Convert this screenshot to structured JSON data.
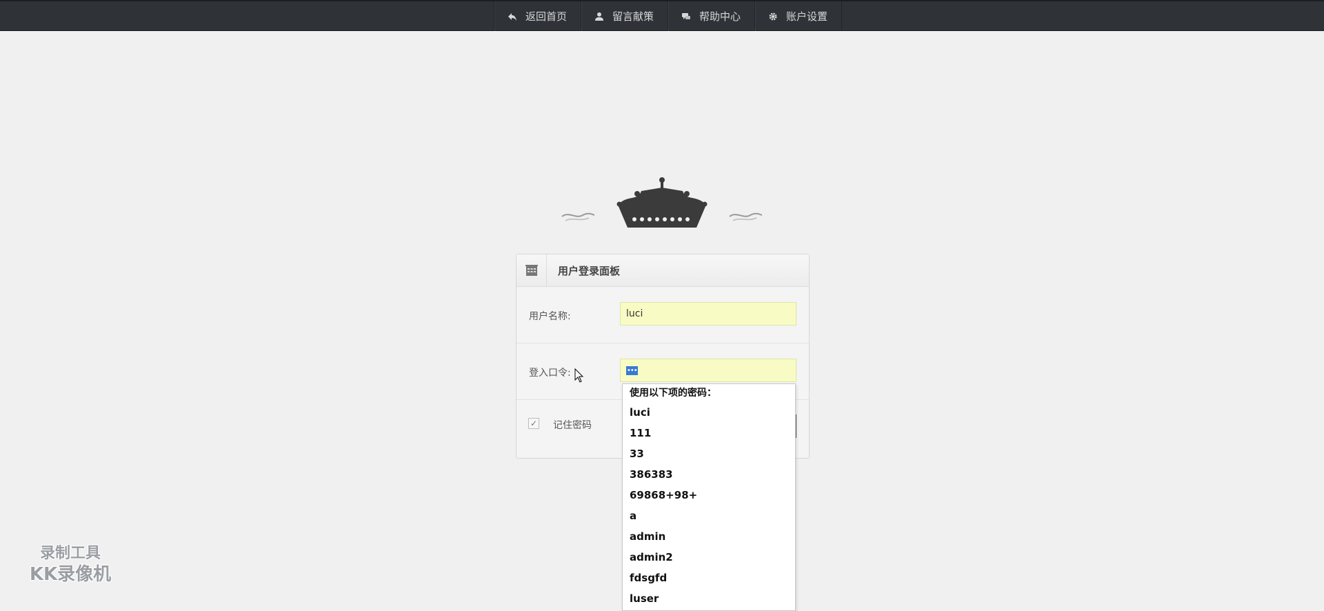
{
  "topnav": {
    "items": [
      {
        "label": "返回首页",
        "icon": "back-arrow-icon"
      },
      {
        "label": "留言献策",
        "icon": "user-icon"
      },
      {
        "label": "帮助中心",
        "icon": "chat-bubble-icon"
      },
      {
        "label": "账户设置",
        "icon": "gear-icon"
      }
    ]
  },
  "login": {
    "title": "用户登录面板",
    "username_label": "用户名称:",
    "username_value": "luci",
    "password_label": "登入口令:",
    "password_value": "•••",
    "remember_label": "记住密码",
    "remember_checked": true
  },
  "autocomplete": {
    "title": "使用以下项的密码：",
    "items": [
      "luci",
      "111",
      "33",
      "386383",
      "69868+98+",
      "a",
      "admin",
      "admin2",
      "fdsgfd",
      "luser"
    ]
  },
  "watermark": {
    "line1": "录制工具",
    "line2": "KK录像机"
  },
  "colors": {
    "topbar": "#2f3237",
    "input_autofill": "#f8fcc4",
    "page_bg": "#f0f0f0"
  }
}
